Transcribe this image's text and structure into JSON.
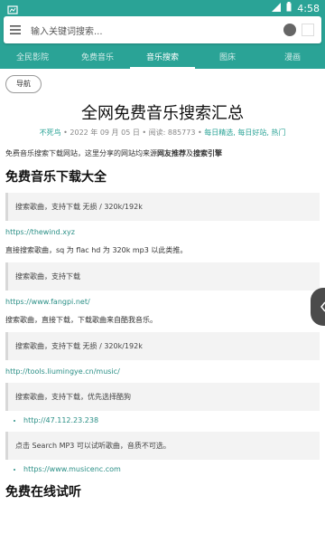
{
  "status_bar": {
    "time": "4:58"
  },
  "search": {
    "placeholder": "输入关键词搜索..."
  },
  "tabs": [
    {
      "label": "全民影院"
    },
    {
      "label": "免费音乐"
    },
    {
      "label": "音乐搜索"
    },
    {
      "label": "图床"
    },
    {
      "label": "漫画"
    }
  ],
  "back_label": "导航",
  "article": {
    "title": "全网免费音乐搜索汇总",
    "author": "不死鸟",
    "date": "2022 年 09 月 05 日",
    "reads_label": "阅读: 885773",
    "tag_daily": "每日精选",
    "tag_good": "每日好站",
    "tag_hot": "热门",
    "intro_prefix": "免费音乐搜索下载网站，这里分享的网站均来源",
    "intro_bold1": "网友推荐",
    "intro_mid": "及",
    "intro_bold2": "搜索引擎",
    "section1_title": "免费音乐下载大全",
    "quote1": "搜索歌曲，支持下载 无损 / 320k/192k",
    "link1": "https://thewind.xyz",
    "para1": "直接搜索歌曲，sq 为 flac hd 为 320k mp3 以此类推。",
    "quote2": "搜索歌曲，支持下载",
    "link2": "https://www.fangpi.net/",
    "para2": "搜索歌曲，直接下载，下载歌曲来自酷我音乐。",
    "quote3": "搜索歌曲，支持下载 无损 / 320k/192k",
    "link3": "http://tools.liumingye.cn/music/",
    "quote4": "搜索歌曲，支持下载，优先选择酷狗",
    "bullet1": "http://47.112.23.238",
    "quote5": "点击 Search MP3 可以试听歌曲，音质不可选。",
    "bullet2": "https://www.musicenc.com",
    "section2_title": "免费在线试听"
  },
  "colors": {
    "accent": "#2aa396",
    "link": "#2a8f86"
  }
}
